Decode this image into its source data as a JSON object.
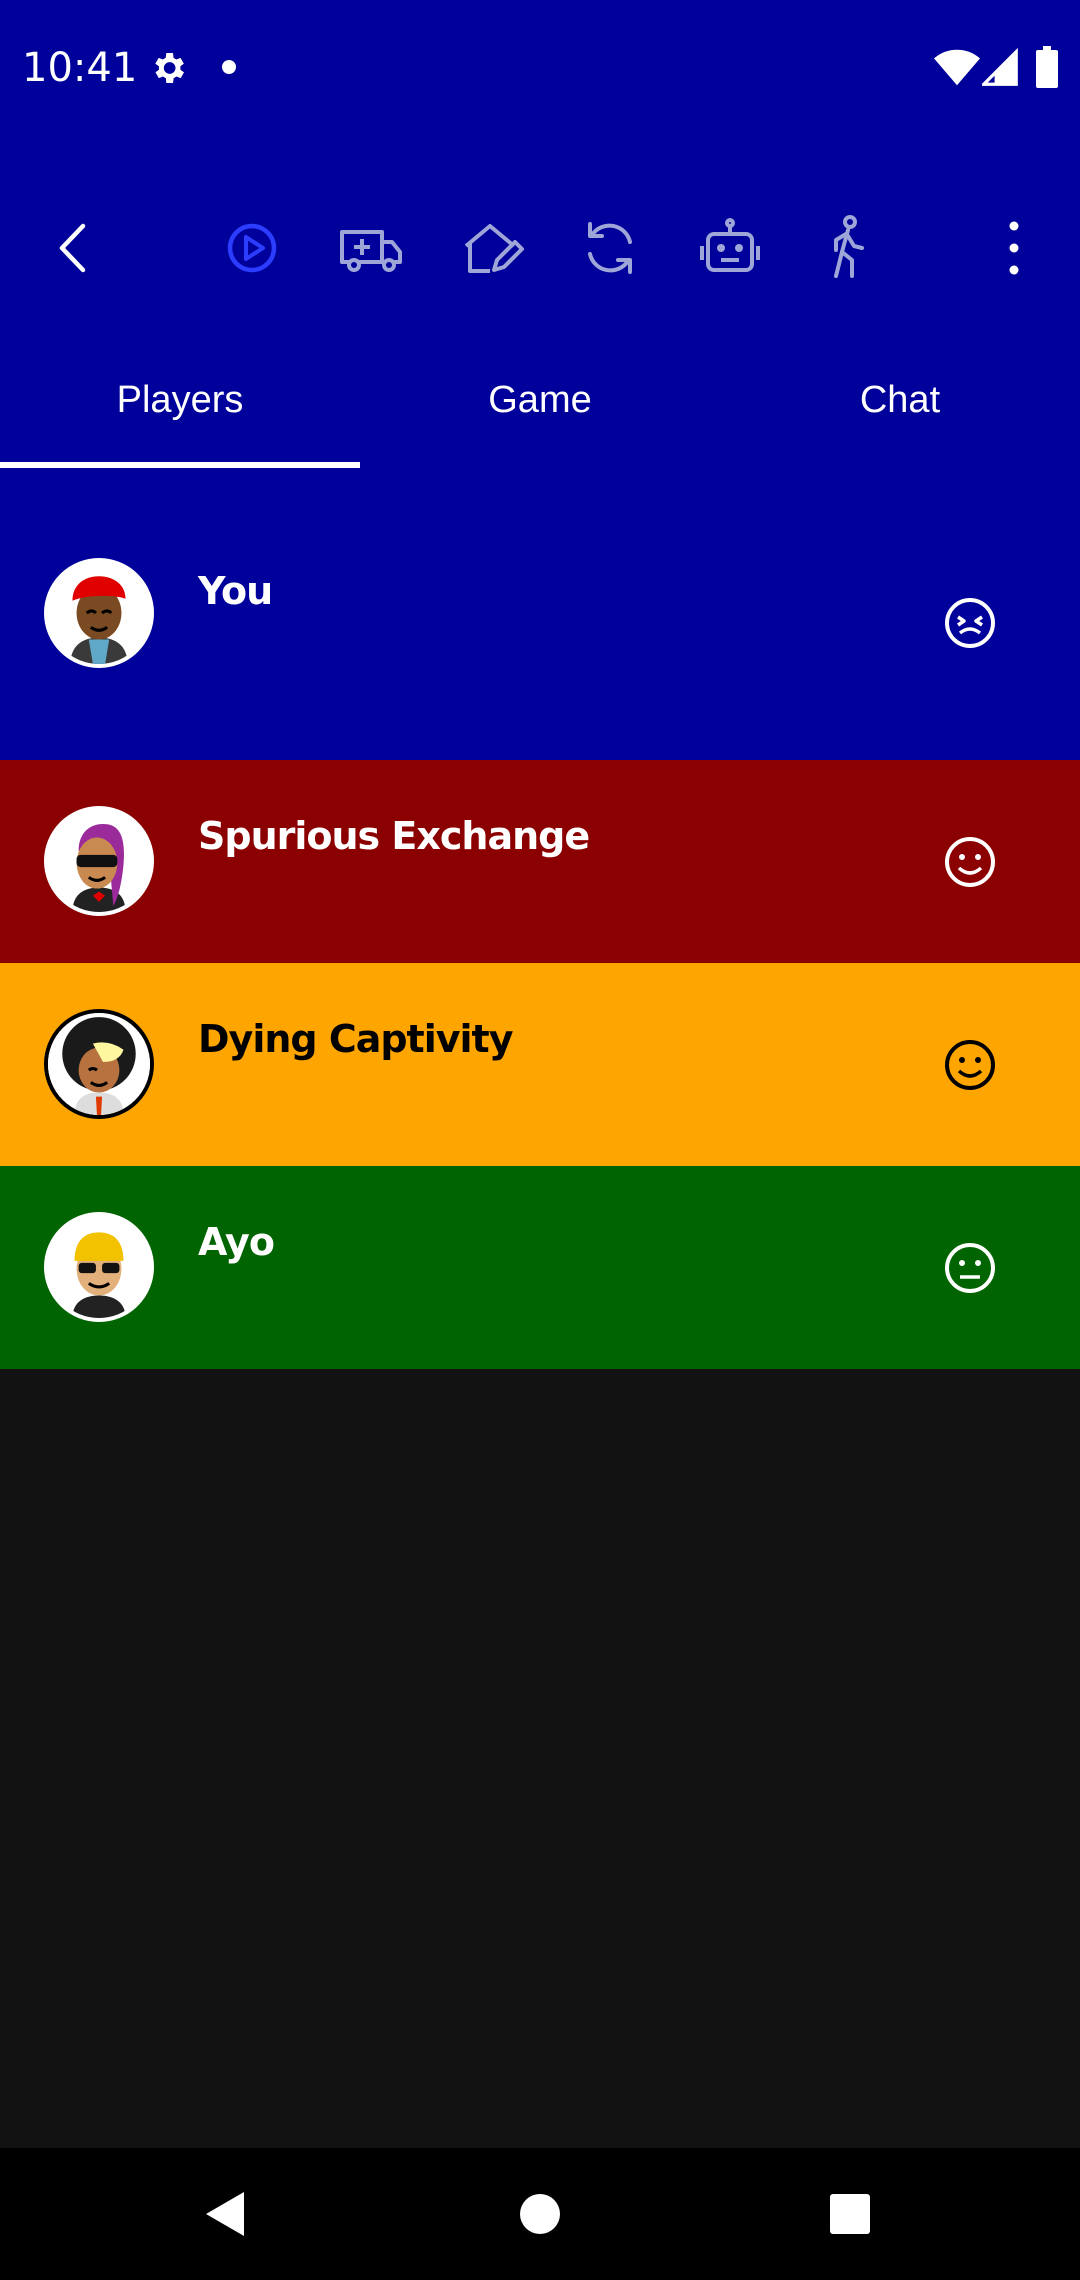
{
  "status_bar": {
    "time": "10:41",
    "icons": [
      "gear-icon",
      "notification-dot-icon",
      "wifi-icon",
      "cellular-signal-icon",
      "battery-icon"
    ]
  },
  "toolbar": {
    "icons": [
      "back-arrow-icon",
      "play-circle-icon",
      "ambulance-icon",
      "house-edit-icon",
      "refresh-icon",
      "robot-icon",
      "walking-person-icon",
      "more-vertical-icon"
    ],
    "active_color": "#2d3dff",
    "icon_color": "#9ea6d8"
  },
  "tabs": [
    {
      "label": "Players",
      "selected": true
    },
    {
      "label": "Game",
      "selected": false
    },
    {
      "label": "Chat",
      "selected": false
    }
  ],
  "players": [
    {
      "name": "You",
      "color": "#00009a",
      "text_color": "#ffffff",
      "mood_icon": "wink-face-icon"
    },
    {
      "name": "Spurious Exchange",
      "color": "#8b0000",
      "text_color": "#ffffff",
      "mood_icon": "smile-face-icon"
    },
    {
      "name": "Dying Captivity",
      "color": "#ffa500",
      "text_color": "#000000",
      "mood_icon": "smile-face-icon"
    },
    {
      "name": "Ayo",
      "color": "#006400",
      "text_color": "#ffffff",
      "mood_icon": "neutral-face-icon"
    }
  ],
  "nav_bar": {
    "icons": [
      "nav-back-icon",
      "nav-home-icon",
      "nav-recents-icon"
    ]
  },
  "colors": {
    "primary": "#00009a",
    "background": "#121212"
  }
}
